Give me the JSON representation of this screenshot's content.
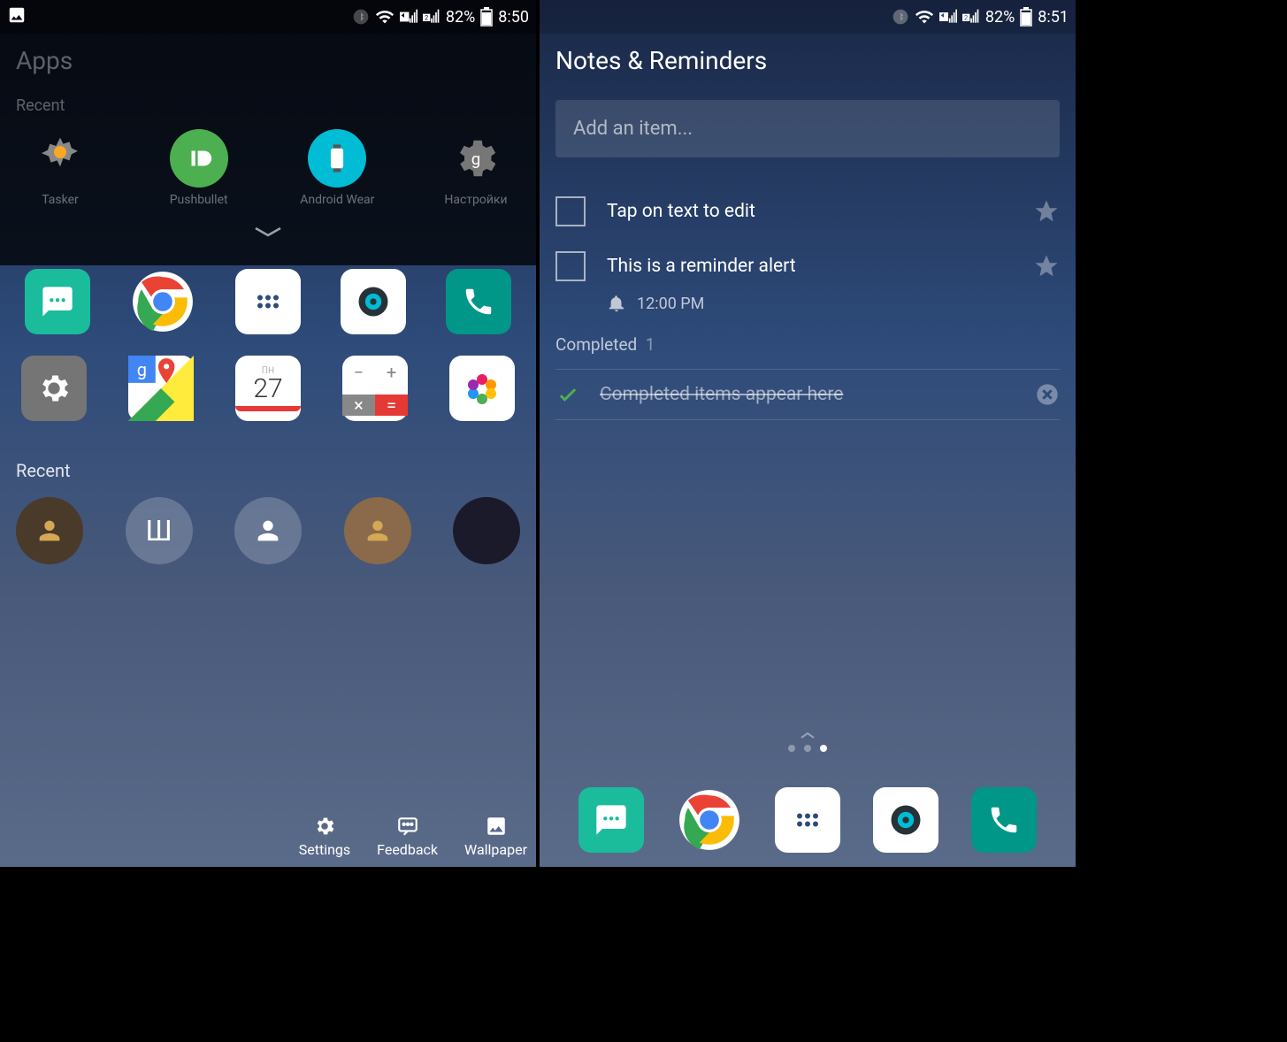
{
  "left": {
    "status": {
      "battery": "82%",
      "time": "8:50"
    },
    "header": "Apps",
    "section1": "Recent",
    "apps": [
      {
        "name": "Tasker"
      },
      {
        "name": "Pushbullet"
      },
      {
        "name": "Android Wear"
      },
      {
        "name": "Настройки"
      }
    ],
    "recentLabel": "Recent",
    "bottomActions": [
      {
        "label": "Settings"
      },
      {
        "label": "Feedback"
      },
      {
        "label": "Wallpaper"
      }
    ],
    "calendarDay": "ПН",
    "calendarDate": "27"
  },
  "right": {
    "status": {
      "battery": "82%",
      "time": "8:51"
    },
    "title": "Notes & Reminders",
    "addPlaceholder": "Add an item...",
    "notes": [
      {
        "text": "Tap on text to edit"
      },
      {
        "text": "This is a reminder alert"
      }
    ],
    "reminderTime": "12:00 PM",
    "completedLabel": "Completed",
    "completedCount": "1",
    "completedItem": "Completed items appear here"
  }
}
